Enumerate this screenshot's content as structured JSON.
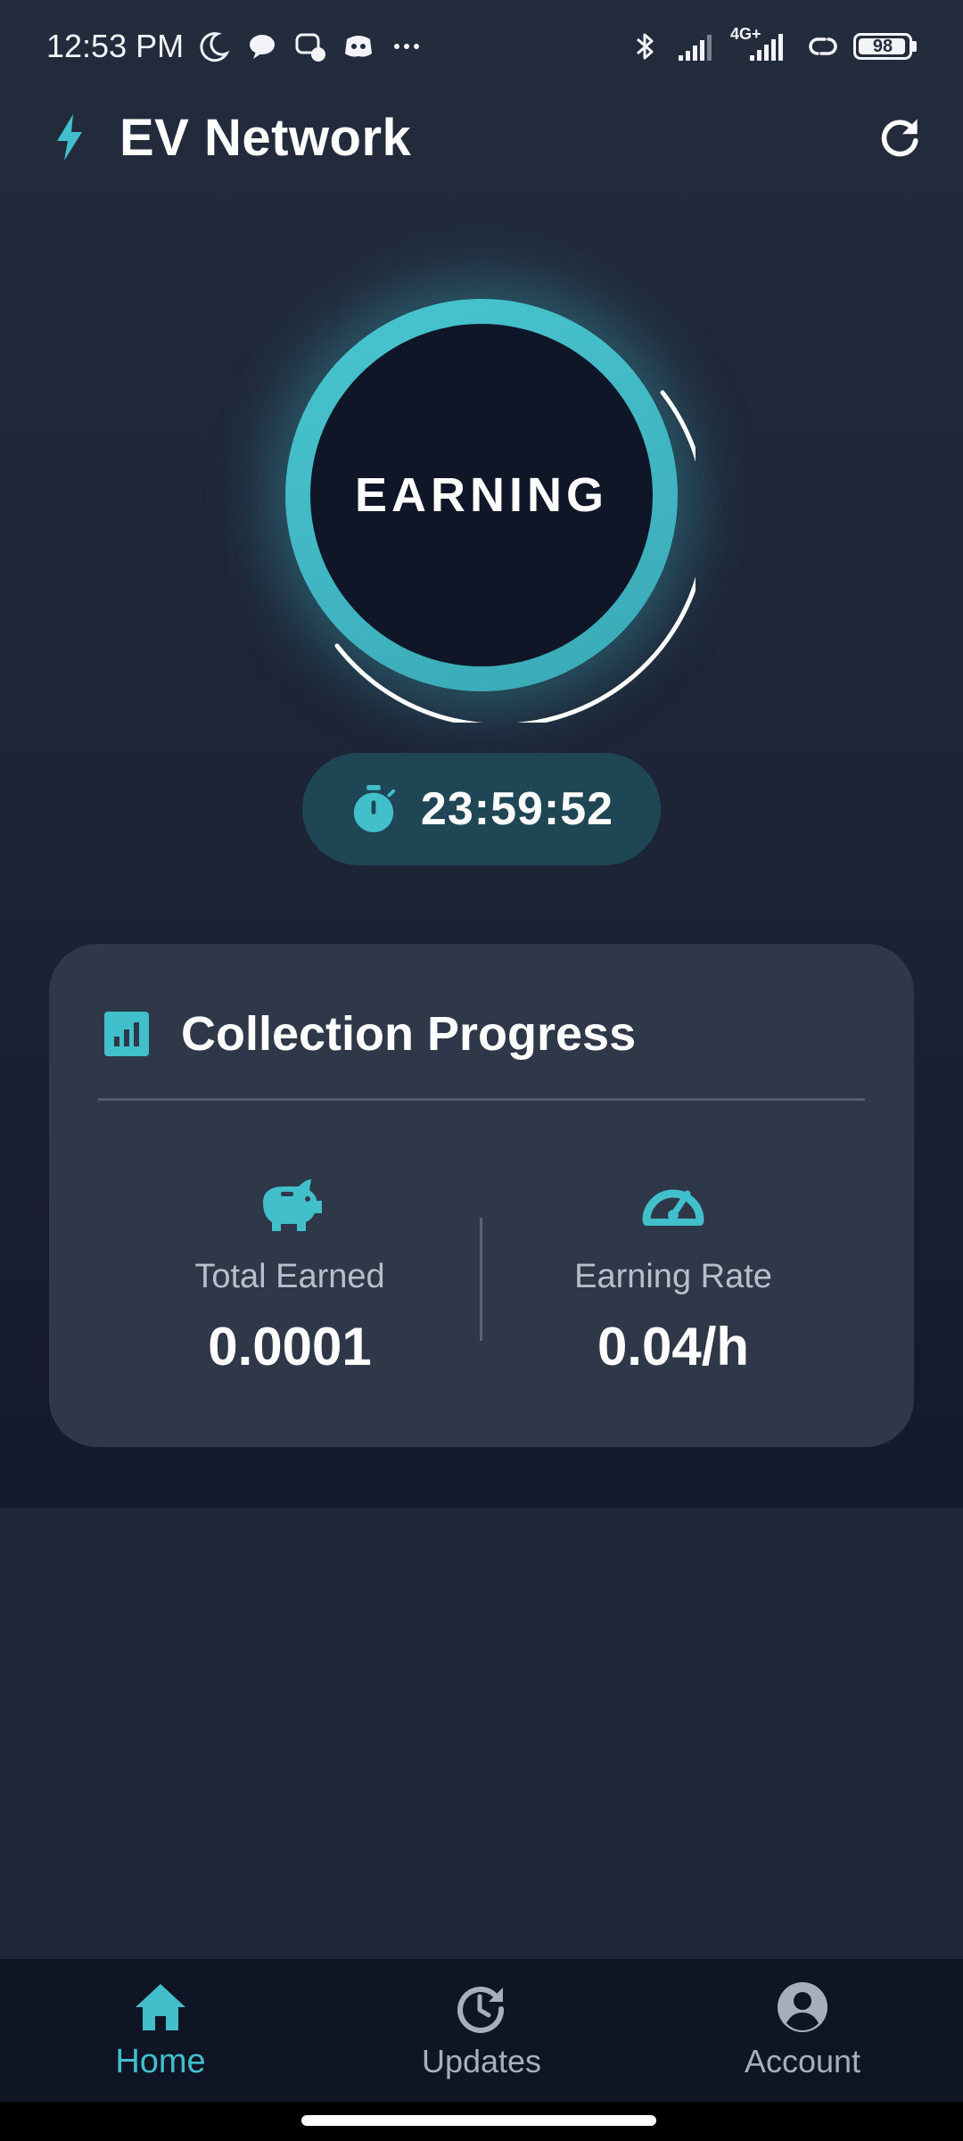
{
  "status_bar": {
    "time": "12:53 PM",
    "network_label": "4G+",
    "battery": "98",
    "icons": [
      "moon-icon",
      "chat-bubble-icon",
      "messenger-icon",
      "discord-icon",
      "more-dots-icon",
      "bluetooth-icon",
      "signal-icon",
      "signal-4g-icon",
      "link-icon",
      "battery-icon"
    ]
  },
  "header": {
    "title": "EV Network",
    "brand_icon": "lightning-bolt-icon",
    "refresh_icon": "refresh-icon"
  },
  "earning": {
    "label": "EARNING",
    "accent_color": "#41c0cc"
  },
  "timer": {
    "icon": "stopwatch-icon",
    "value": "23:59:52"
  },
  "card": {
    "title": "Collection Progress",
    "title_icon": "bar-chart-icon",
    "stats": {
      "total_earned": {
        "icon": "piggy-bank-icon",
        "label": "Total Earned",
        "value": "0.0001"
      },
      "earning_rate": {
        "icon": "speedometer-icon",
        "label": "Earning Rate",
        "value": "0.04/h"
      }
    }
  },
  "nav": {
    "items": [
      {
        "label": "Home",
        "icon": "home-icon",
        "active": true
      },
      {
        "label": "Updates",
        "icon": "history-icon",
        "active": false
      },
      {
        "label": "Account",
        "icon": "account-circle-icon",
        "active": false
      }
    ]
  },
  "colors": {
    "background": "#1f2638",
    "card": "#2e3849",
    "accent": "#41c0cc",
    "nav_background": "#0f1525"
  }
}
